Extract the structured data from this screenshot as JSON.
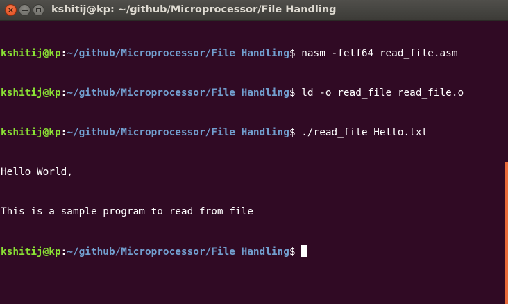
{
  "window": {
    "title": "kshitij@kp: ~/github/Microprocessor/File Handling",
    "close_label": "×",
    "colors": {
      "background": "#300a24",
      "user": "#8ae234",
      "path": "#729fcf",
      "scrollbar": "#e86a3a"
    }
  },
  "terminal": {
    "prompt": {
      "user_host": "kshitij@kp",
      "colon": ":",
      "path": "~/github/Microprocessor/File Handling",
      "symbol": "$"
    },
    "lines": [
      {
        "type": "command",
        "text": " nasm -felf64 read_file.asm"
      },
      {
        "type": "command",
        "text": " ld -o read_file read_file.o"
      },
      {
        "type": "command",
        "text": " ./read_file Hello.txt"
      },
      {
        "type": "output",
        "text": "Hello World,"
      },
      {
        "type": "output",
        "text": "This is a sample program to read from file"
      },
      {
        "type": "command",
        "text": " "
      }
    ]
  }
}
